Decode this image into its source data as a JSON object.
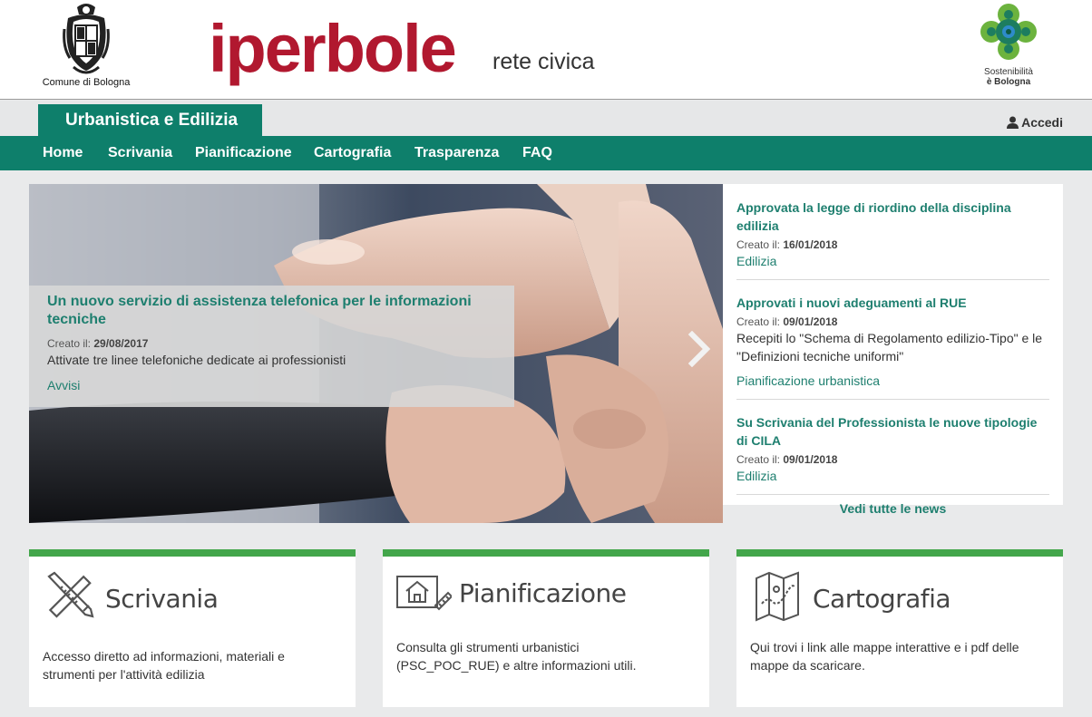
{
  "header": {
    "org_name": "Comune di Bologna",
    "brand": "iperbole",
    "brand_sub": "rete civica",
    "sustainability_line1": "Sostenibilità",
    "sustainability_line2": "è Bologna"
  },
  "section": {
    "title": "Urbanistica e Edilizia",
    "login_label": "Accedi"
  },
  "nav": {
    "items": [
      "Home",
      "Scrivania",
      "Pianificazione",
      "Cartografia",
      "Trasparenza",
      "FAQ"
    ]
  },
  "carousel": {
    "title": "Un nuovo servizio di assistenza telefonica per le informazioni tecniche",
    "date_label": "Creato il:",
    "date": "29/08/2017",
    "text": "Attivate tre linee telefoniche dedicate ai professionisti",
    "category": "Avvisi"
  },
  "news": {
    "items": [
      {
        "title": "Approvata la legge di riordino della disciplina edilizia",
        "date_label": "Creato il:",
        "date": "16/01/2018",
        "desc": "",
        "category": "Edilizia"
      },
      {
        "title": "Approvati i nuovi adeguamenti al RUE",
        "date_label": "Creato il:",
        "date": "09/01/2018",
        "desc": "Recepiti lo \"Schema di Regolamento edilizio-Tipo\" e le \"Definizioni tecniche uniformi\"",
        "category": "Pianificazione urbanistica"
      },
      {
        "title": "Su Scrivania del Professionista le nuove tipologie di CILA",
        "date_label": "Creato il:",
        "date": "09/01/2018",
        "desc": "",
        "category": "Edilizia"
      }
    ],
    "all_label": "Vedi tutte le news"
  },
  "cards": [
    {
      "title": "Scrivania",
      "icon": "ruler-pencil-icon",
      "text": "Accesso diretto ad informazioni, materiali e strumenti per l'attività edilizia"
    },
    {
      "title": "Pianificazione",
      "icon": "house-plan-icon",
      "text": "Consulta gli strumenti urbanistici (PSC_POC_RUE) e altre informazioni utili."
    },
    {
      "title": "Cartografia",
      "icon": "map-icon",
      "text": "Qui trovi i link alle mappe interattive e i pdf delle mappe da scaricare."
    }
  ],
  "colors": {
    "brand_red": "#b1182f",
    "primary_green": "#0e7f6b",
    "card_accent": "#43a64b"
  }
}
